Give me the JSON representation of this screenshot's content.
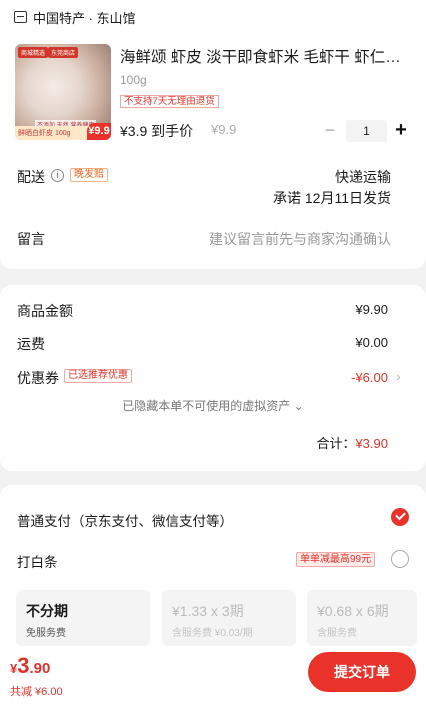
{
  "shop": {
    "name": "中国特产 · 东山馆"
  },
  "product": {
    "thumb_tag1": "商城精选",
    "thumb_tag2": "东莞商店",
    "thumb_sub": "不添加 天然 营养健康",
    "thumb_bar": "鲜晒白虾皮 100g",
    "thumb_price": "¥9.9",
    "title": "海鲜颂 虾皮 淡干即食虾米 毛虾干 虾仁海鲜干货",
    "spec": "100g",
    "badge": "不支持7天无理由退货",
    "price_text": "¥3.9 到手价",
    "orig_price": "¥9.9",
    "qty": "1",
    "minus": "−",
    "plus": "+"
  },
  "delivery": {
    "label": "配送",
    "info_icon": "i",
    "late_tag": "晚发赔",
    "mode": "快递运输",
    "date": "承诺 12月11日发货"
  },
  "message": {
    "label": "留言",
    "placeholder": "建议留言前先与商家沟通确认"
  },
  "summary": {
    "goods_label": "商品金额",
    "goods_value": "¥9.90",
    "freight_label": "运费",
    "freight_value": "¥0.00",
    "coupon_label": "优惠券",
    "coupon_tag": "已选推荐优惠",
    "coupon_value": "-¥6.00",
    "chevron": "›",
    "hidden_note": "已隐藏本单不可使用的虚拟资产",
    "hidden_chev": "⌄",
    "total_label": "合计：",
    "total_value": "¥3.90"
  },
  "payment": {
    "normal_label": "普通支付（京东支付、微信支付等）",
    "baitiao_label": "打白条",
    "baitiao_tag": "单单减最高99元",
    "plans": [
      {
        "main": "不分期",
        "sub": "免服务费"
      },
      {
        "main": "¥1.33 x 3期",
        "sub": "含服务费 ¥0.03/期"
      },
      {
        "main": "¥0.68 x 6期",
        "sub": "含服务费"
      }
    ]
  },
  "bottom": {
    "currency": "¥",
    "price_int": "3",
    "price_dec": ".90",
    "save_text": "共减 ¥6.00",
    "submit_label": "提交订单"
  },
  "colors": {
    "accent": "#e8322a",
    "late_tag": "#e8651a",
    "background": "#f2f2f2"
  }
}
